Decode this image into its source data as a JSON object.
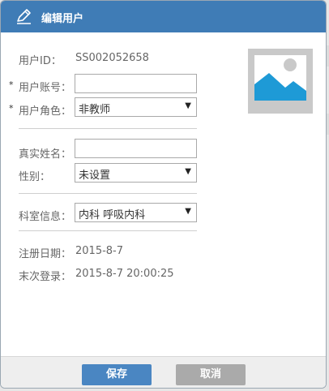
{
  "dialog": {
    "title": "编辑用户",
    "title_icon": "pencil-icon"
  },
  "form": {
    "user_id": {
      "label": "用户ID：",
      "value": "SS002052658"
    },
    "account": {
      "required_mark": "*",
      "label": "用户账号：",
      "value": ""
    },
    "role": {
      "required_mark": "*",
      "label": "用户角色：",
      "selected": "非教师"
    },
    "real_name": {
      "label": "真实姓名：",
      "value": ""
    },
    "gender": {
      "label": "性别：",
      "selected": "未设置"
    },
    "department": {
      "label": "科室信息：",
      "selected": "内科 呼吸内科"
    },
    "register_date": {
      "label": "注册日期：",
      "value": "2015-8-7"
    },
    "last_login": {
      "label": "末次登录：",
      "value": "2015-8-7 20:00:25"
    }
  },
  "avatar": {
    "icon": "image-placeholder-icon"
  },
  "footer": {
    "save_label": "保存",
    "cancel_label": "取消"
  },
  "colors": {
    "titlebar": "#3f7cb6",
    "save_button": "#4a86c2",
    "cancel_button": "#aaaaaa",
    "avatar_bg": "#c9c9c9",
    "avatar_image": "#1e9ad6"
  }
}
